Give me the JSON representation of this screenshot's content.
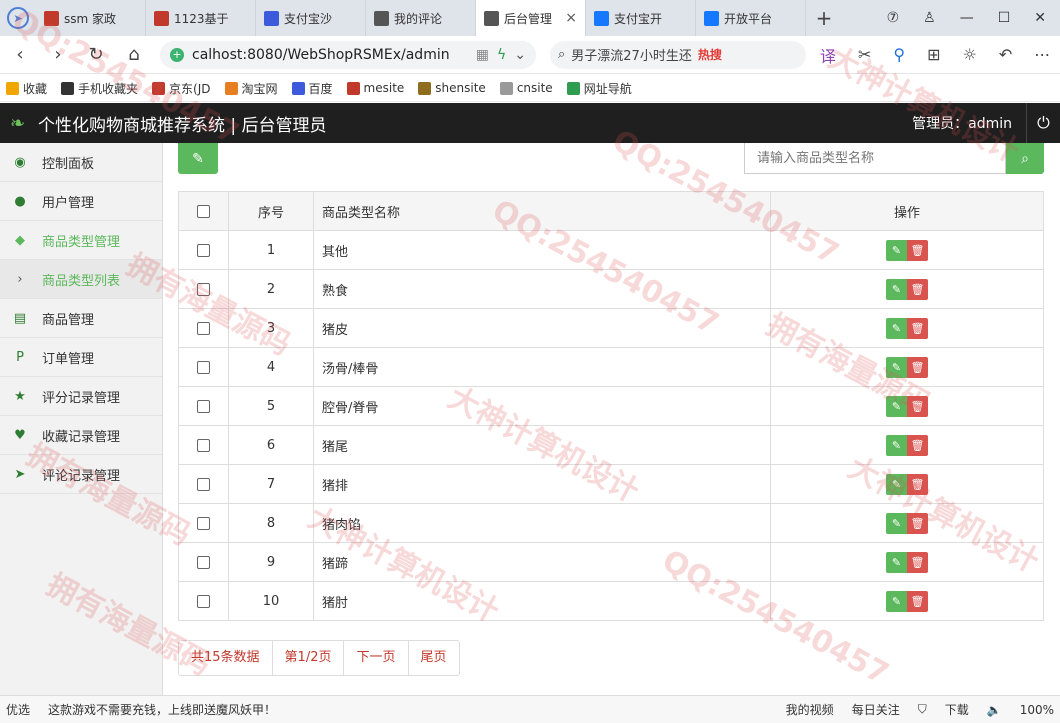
{
  "browser": {
    "tabs": [
      {
        "label": "ssm 家政",
        "color": "#c0392b"
      },
      {
        "label": "1123基于",
        "color": "#c0392b"
      },
      {
        "label": "支付宝沙",
        "color": "#3b5bdb"
      },
      {
        "label": "我的评论",
        "color": "#555555"
      },
      {
        "label": "后台管理",
        "color": "#555555",
        "active": true
      },
      {
        "label": "支付宝开",
        "color": "#1677ff"
      },
      {
        "label": "开放平台",
        "color": "#1677ff"
      }
    ],
    "close_glyph": "×",
    "add_glyph": "+",
    "url": "calhost:8080/WebShopRSMEx/admin",
    "search_text": "男子漂流27小时生还",
    "search_hot": "热搜",
    "bookmarks": [
      "收藏",
      "手机收藏夹",
      "京东(JD",
      "淘宝网",
      "百度",
      "mesite",
      "shensite",
      "cnsite",
      "网址导航"
    ]
  },
  "header": {
    "title": "个性化购物商城推荐系统 | 后台管理员",
    "admin_label": "管理员：admin"
  },
  "sidebar": {
    "items": [
      {
        "label": "控制面板",
        "icon": "dashboard-icon",
        "glyph": "◉"
      },
      {
        "label": "用户管理",
        "icon": "user-icon",
        "glyph": "●"
      },
      {
        "label": "商品类型管理",
        "icon": "tags-icon",
        "glyph": "◆",
        "active": true
      },
      {
        "label": "商品类型列表",
        "icon": "chevron-right-icon",
        "glyph": "›",
        "sub": true
      },
      {
        "label": "商品管理",
        "icon": "barcode-icon",
        "glyph": "▤"
      },
      {
        "label": "订单管理",
        "icon": "payment-icon",
        "glyph": "P"
      },
      {
        "label": "评分记录管理",
        "icon": "star-icon",
        "glyph": "★"
      },
      {
        "label": "收藏记录管理",
        "icon": "heart-icon",
        "glyph": "♥"
      },
      {
        "label": "评论记录管理",
        "icon": "send-icon",
        "glyph": "➤"
      }
    ]
  },
  "toolbar": {
    "add_icon": "edit-icon",
    "search_placeholder": "请输入商品类型名称"
  },
  "table": {
    "headers": {
      "index": "序号",
      "name": "商品类型名称",
      "ops": "操作"
    },
    "rows": [
      {
        "index": "1",
        "name": "其他"
      },
      {
        "index": "2",
        "name": "熟食"
      },
      {
        "index": "3",
        "name": "猪皮"
      },
      {
        "index": "4",
        "name": "汤骨/棒骨"
      },
      {
        "index": "5",
        "name": "腔骨/脊骨"
      },
      {
        "index": "6",
        "name": "猪尾"
      },
      {
        "index": "7",
        "name": "猪排"
      },
      {
        "index": "8",
        "name": "猪肉馅"
      },
      {
        "index": "9",
        "name": "猪蹄"
      },
      {
        "index": "10",
        "name": "猪肘"
      }
    ]
  },
  "pager": {
    "total": "共15条数据",
    "page": "第1/2页",
    "next": "下一页",
    "last": "尾页"
  },
  "statusbar": {
    "left": "优选",
    "ad": "这款游戏不需要充钱，上线即送魔风妖甲！",
    "video": "我的视频",
    "daily": "每日关注",
    "download": "下载",
    "zoom": "100%"
  },
  "watermark": {
    "texts": [
      "QQ:254540457",
      "拥有海量源码",
      "大神计算机设计"
    ]
  },
  "colors": {
    "accent": "#5cb85c",
    "danger": "#d9534f",
    "header_bg": "#1f1f1f"
  }
}
